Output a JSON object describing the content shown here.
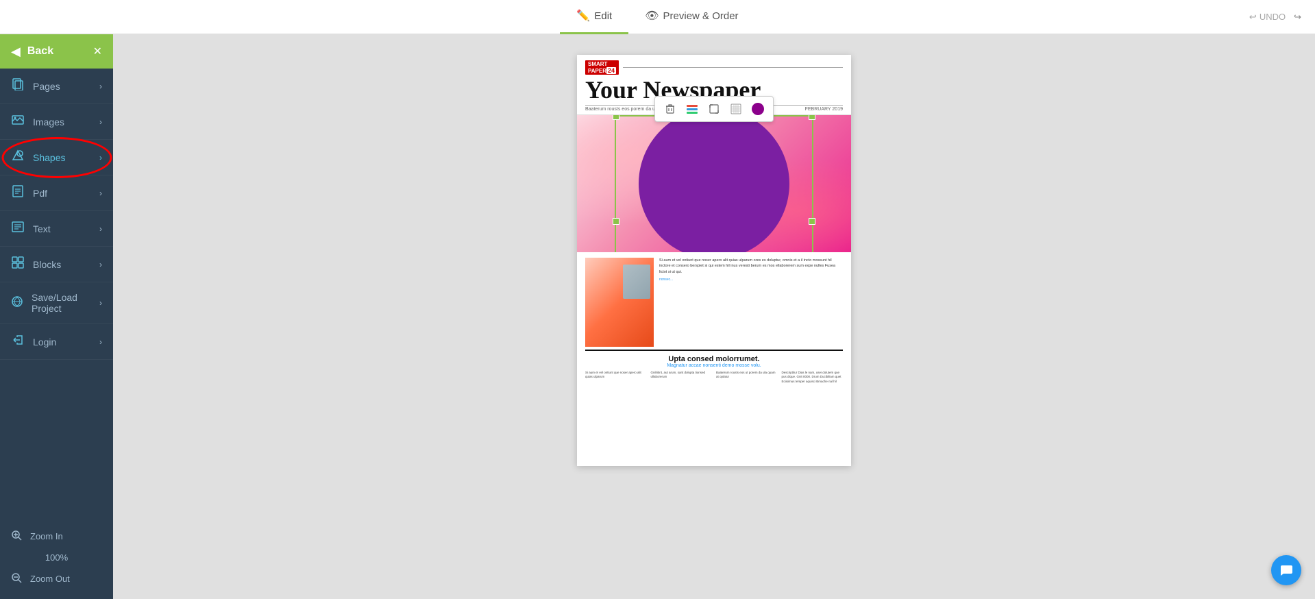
{
  "topbar": {
    "edit_label": "Edit",
    "preview_label": "Preview & Order",
    "undo_label": "UNDO"
  },
  "sidebar": {
    "back_label": "Back",
    "items": [
      {
        "id": "pages",
        "label": "Pages",
        "icon": "📄"
      },
      {
        "id": "images",
        "label": "Images",
        "icon": "🖼"
      },
      {
        "id": "shapes",
        "label": "Shapes",
        "icon": "⬡",
        "active": true
      },
      {
        "id": "pdf",
        "label": "Pdf",
        "icon": "📋"
      },
      {
        "id": "text",
        "label": "Text",
        "icon": "📝"
      },
      {
        "id": "blocks",
        "label": "Blocks",
        "icon": "⊞"
      },
      {
        "id": "saveload",
        "label": "Save/Load Project",
        "icon": "☁"
      },
      {
        "id": "login",
        "label": "Login",
        "icon": "→"
      }
    ],
    "zoom_in_label": "Zoom In",
    "zoom_out_label": "Zoom Out",
    "zoom_percent": "100%"
  },
  "newspaper": {
    "logo": "SMART PAPER",
    "logo_num": "24",
    "title": "Your Newspaper",
    "date": "FEBRUARY 2019",
    "tagline": "Baaterum rousts eos porem da ula quan",
    "bottom_title": "Upta consed molorrumet.",
    "bottom_subtitle": "Magnatur accae nonsenti demo mosse volu.",
    "body_text": "Si aum et vel ontiunt que noser apero alit quias ulparum ores es doluptur, omnis et a il incto mossunt hil inctore et consero berspiet si qui estem hil inus veresti berum es mos ellaborerem sum expe nulles Fusea lictot si ut qui.",
    "col1_text": "Si aum et vel ontiunt que noser apero alit quias ulparum",
    "col2_text": "Gnihitint, aut arum, sant dolupta tionsed ullaborerum",
    "col3_text": "Baaterum rousts eos ut porem da ula quam at optatur",
    "col4_text": "Descriptitur Dias le nam, usei dolutem que pus dique. Gnit 0000. Drum Ducibiliam quet Eciisimus temper aquisci Bmache nal hil"
  }
}
